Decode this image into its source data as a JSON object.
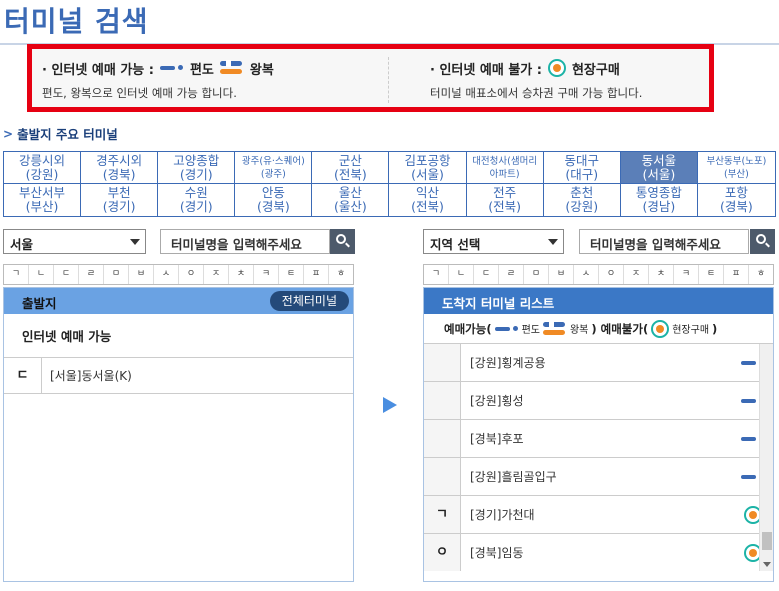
{
  "page": {
    "title": "터미널 검색"
  },
  "legend": {
    "online_title": "· 인터넷 예매 가능 :",
    "oneway_label": "편도",
    "round_label": "왕복",
    "online_desc": "편도, 왕복으로 인터넷 예매 가능 합니다.",
    "offline_title": "· 인터넷 예매 불가 :",
    "site_label": "현장구매",
    "offline_desc": "터미널 매표소에서 승차권 구매 가능 합니다."
  },
  "major": {
    "heading": "출발지 주요 터미널",
    "terminals": [
      [
        "강릉시외",
        "(강원)"
      ],
      [
        "경주시외",
        "(경북)"
      ],
      [
        "고양종합",
        "(경기)"
      ],
      [
        "광주(유·스퀘어)",
        "(광주)"
      ],
      [
        "군산",
        "(전북)"
      ],
      [
        "김포공항",
        "(서울)"
      ],
      [
        "대전청사(샘머리",
        "아파트)"
      ],
      [
        "동대구",
        "(대구)"
      ],
      [
        "동서울",
        "(서울)"
      ],
      [
        "부산동부(노포)",
        "(부산)"
      ],
      [
        "부산서부",
        "(부산)"
      ],
      [
        "부천",
        "(경기)"
      ],
      [
        "수원",
        "(경기)"
      ],
      [
        "안동",
        "(경북)"
      ],
      [
        "울산",
        "(울산)"
      ],
      [
        "익산",
        "(전북)"
      ],
      [
        "전주",
        "(전북)"
      ],
      [
        "춘천",
        "(강원)"
      ],
      [
        "통영종합",
        "(경남)"
      ],
      [
        "포항",
        "(경북)"
      ]
    ]
  },
  "left": {
    "region_select": "서울",
    "search_placeholder": "터미널명을 입력해주세요",
    "panel_title": "출발지",
    "all_button": "전체터미널",
    "available_label": "인터넷 예매 가능",
    "rows": [
      {
        "cons": "ㄷ",
        "name": "[서울]동서울(K)"
      }
    ]
  },
  "right": {
    "region_select": "지역 선택",
    "search_placeholder": "터미널명을 입력해주세요",
    "panel_title": "도착지 터미널 리스트",
    "legend_avail": "예매가능(",
    "legend_oneway": "편도",
    "legend_round": "왕복",
    "legend_unavail": ") 예매불가(",
    "legend_site": "현장구매",
    "legend_close": ")",
    "rows": [
      {
        "cons": "",
        "name": "[강원]횡계공용",
        "icon": "oneway-icon"
      },
      {
        "cons": "",
        "name": "[강원]횡성",
        "icon": "oneway-icon"
      },
      {
        "cons": "",
        "name": "[경북]후포",
        "icon": "oneway-icon"
      },
      {
        "cons": "",
        "name": "[강원]흘림골입구",
        "icon": "oneway-icon"
      },
      {
        "cons": "ㄱ",
        "name": "[경기]가천대",
        "icon": "site-purchase-icon"
      },
      {
        "cons": "ㅇ",
        "name": "[경북]임동",
        "icon": "site-purchase-icon"
      }
    ]
  },
  "consonants": [
    "ㄱ",
    "ㄴ",
    "ㄷ",
    "ㄹ",
    "ㅁ",
    "ㅂ",
    "ㅅ",
    "ㅇ",
    "ㅈ",
    "ㅊ",
    "ㅋ",
    "ㅌ",
    "ㅍ",
    "ㅎ"
  ],
  "colors": {
    "primary": "#3b6ab5",
    "accent": "#f08a24",
    "highlight": "#e60012",
    "site": "#1cb3a6"
  }
}
